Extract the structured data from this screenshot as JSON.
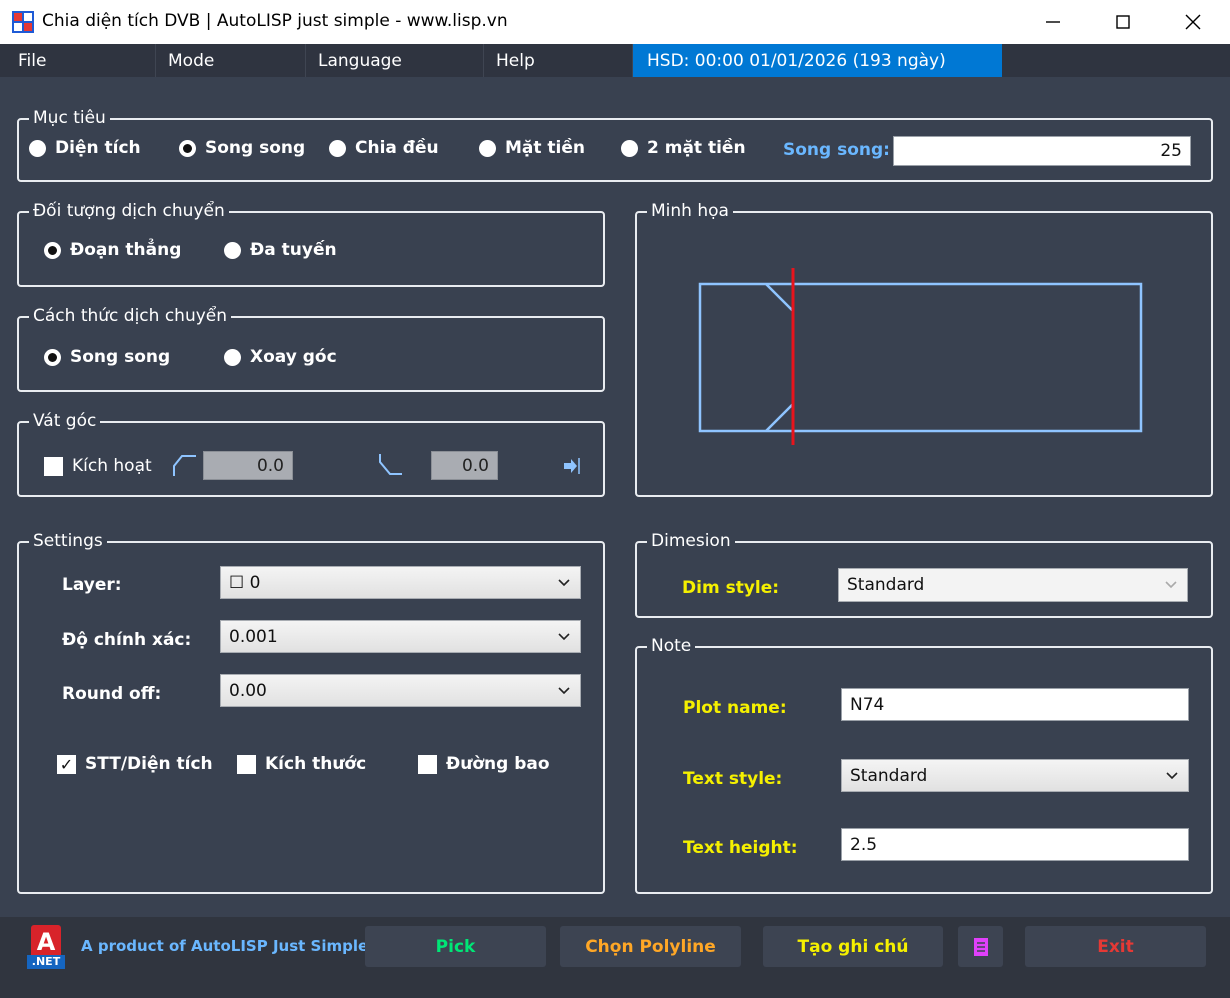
{
  "window": {
    "title": "Chia diện tích DVB | AutoLISP just simple - www.lisp.vn"
  },
  "menu": {
    "items": [
      "File",
      "Mode",
      "Language",
      "Help"
    ],
    "status": "HSD: 00:00 01/01/2026 (193 ngày)"
  },
  "target": {
    "legend": "Mục tiêu",
    "options": [
      "Diện tích",
      "Song song",
      "Chia đều",
      "Mặt tiền",
      "2 mặt tiền"
    ],
    "selected": 1,
    "value_label": "Song song:",
    "value": "25"
  },
  "move_object": {
    "legend": "Đối tượng dịch chuyển",
    "options": [
      "Đoạn thẳng",
      "Đa tuyến"
    ],
    "selected": 0
  },
  "move_method": {
    "legend": "Cách thức dịch chuyển",
    "options": [
      "Song song",
      "Xoay góc"
    ],
    "selected": 0
  },
  "chamfer": {
    "legend": "Vát góc",
    "activate_label": "Kích hoạt",
    "activate_checked": false,
    "value1": "0.0",
    "value2": "0.0"
  },
  "illustration": {
    "legend": "Minh họa"
  },
  "settings": {
    "legend": "Settings",
    "layer_label": "Layer:",
    "layer_value": "☐ 0",
    "precision_label": "Độ chính xác:",
    "precision_value": "0.001",
    "roundoff_label": "Round off:",
    "roundoff_value": "0.00",
    "checks": [
      {
        "label": "STT/Diện tích",
        "checked": true
      },
      {
        "label": "Kích thước",
        "checked": false
      },
      {
        "label": "Đường bao",
        "checked": false
      }
    ]
  },
  "dimension": {
    "legend": "Dimesion",
    "dimstyle_label": "Dim style:",
    "dimstyle_value": "Standard"
  },
  "note": {
    "legend": "Note",
    "plotname_label": "Plot name:",
    "plotname_value": "N74",
    "textstyle_label": "Text style:",
    "textstyle_value": "Standard",
    "textheight_label": "Text height:",
    "textheight_value": "2.5"
  },
  "footer": {
    "logo_letter": "A",
    "logo_sub": ".NET",
    "product_text": "A product of AutoLISP Just Simple",
    "pick_label": "Pick",
    "polyline_label": "Chọn Polyline",
    "note_label": "Tạo ghi chú",
    "exit_label": "Exit"
  },
  "colors": {
    "background": "#394150",
    "accent": "#0078d4",
    "label_yellow": "#f5f000",
    "label_blue": "#6ab7ff",
    "pick_green": "#00e676",
    "polyline_orange": "#ffa726",
    "note_yellow": "#f5f000",
    "exit_red": "#e53935",
    "icon_magenta": "#e040fb"
  }
}
